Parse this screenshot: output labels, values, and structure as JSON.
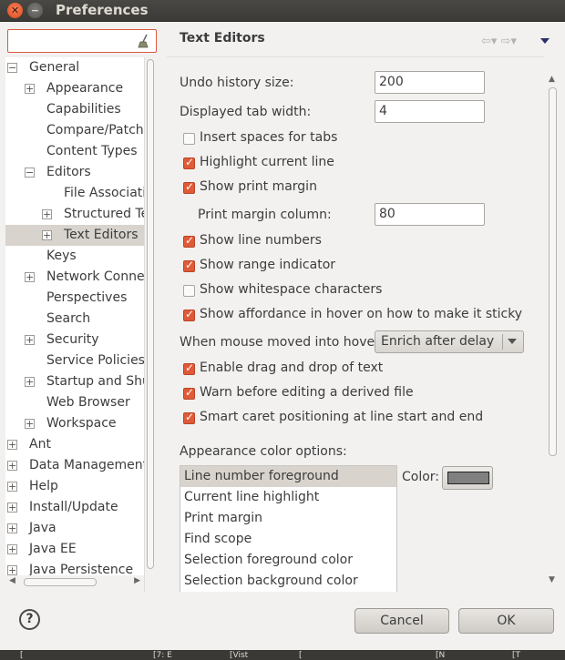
{
  "window": {
    "title": "Preferences",
    "close_glyph": "✕",
    "minimize_glyph": "−"
  },
  "filter": {
    "value": "",
    "icon": "broom-icon"
  },
  "tree": [
    {
      "label": "General",
      "exp": "−",
      "indent": 0
    },
    {
      "label": "Appearance",
      "exp": "+",
      "indent": 1
    },
    {
      "label": "Capabilities",
      "exp": "",
      "indent": 1
    },
    {
      "label": "Compare/Patch",
      "exp": "",
      "indent": 1
    },
    {
      "label": "Content Types",
      "exp": "",
      "indent": 1
    },
    {
      "label": "Editors",
      "exp": "−",
      "indent": 1
    },
    {
      "label": "File Associati",
      "exp": "",
      "indent": 2
    },
    {
      "label": "Structured Te",
      "exp": "+",
      "indent": 2
    },
    {
      "label": "Text Editors",
      "exp": "+",
      "indent": 2,
      "selected": true
    },
    {
      "label": "Keys",
      "exp": "",
      "indent": 1
    },
    {
      "label": "Network Connec",
      "exp": "+",
      "indent": 1
    },
    {
      "label": "Perspectives",
      "exp": "",
      "indent": 1
    },
    {
      "label": "Search",
      "exp": "",
      "indent": 1
    },
    {
      "label": "Security",
      "exp": "+",
      "indent": 1
    },
    {
      "label": "Service Policies",
      "exp": "",
      "indent": 1
    },
    {
      "label": "Startup and Shut",
      "exp": "+",
      "indent": 1
    },
    {
      "label": "Web Browser",
      "exp": "",
      "indent": 1
    },
    {
      "label": "Workspace",
      "exp": "+",
      "indent": 1
    },
    {
      "label": "Ant",
      "exp": "+",
      "indent": 0
    },
    {
      "label": "Data Management",
      "exp": "+",
      "indent": 0
    },
    {
      "label": "Help",
      "exp": "+",
      "indent": 0
    },
    {
      "label": "Install/Update",
      "exp": "+",
      "indent": 0
    },
    {
      "label": "Java",
      "exp": "+",
      "indent": 0
    },
    {
      "label": "Java EE",
      "exp": "+",
      "indent": 0
    },
    {
      "label": "Java Persistence",
      "exp": "+",
      "indent": 0
    }
  ],
  "page": {
    "title": "Text Editors",
    "nav_back": "⇦▾",
    "nav_forward": "⇨▾",
    "undo_label": "Undo history size:",
    "undo_value": "200",
    "tab_label": "Displayed tab width:",
    "tab_value": "4",
    "print_margin_label": "Print margin column:",
    "print_margin_value": "80",
    "hover_label": "When mouse moved into hover:",
    "hover_value": "Enrich after delay",
    "appearance_label": "Appearance color options:",
    "color_label": "Color:",
    "color_value": "#808080",
    "checkboxes_a": [
      {
        "label": "Insert spaces for tabs",
        "checked": false
      },
      {
        "label": "Highlight current line",
        "checked": true
      },
      {
        "label": "Show print margin",
        "checked": true
      }
    ],
    "checkboxes_b": [
      {
        "label": "Show line numbers",
        "checked": true
      },
      {
        "label": "Show range indicator",
        "checked": true
      },
      {
        "label": "Show whitespace characters",
        "checked": false
      },
      {
        "label": "Show affordance in hover on how to make it sticky",
        "checked": true
      }
    ],
    "checkboxes_c": [
      {
        "label": "Enable drag and drop of text",
        "checked": true
      },
      {
        "label": "Warn before editing a derived file",
        "checked": true
      },
      {
        "label": "Smart caret positioning at line start and end",
        "checked": true
      }
    ],
    "color_options": [
      "Line number foreground",
      "Current line highlight",
      "Print margin",
      "Find scope",
      "Selection foreground color",
      "Selection background color"
    ]
  },
  "buttons": {
    "help": "?",
    "cancel": "Cancel",
    "ok": "OK"
  },
  "taskbar": [
    "[",
    "[7: E",
    "[Vist",
    "[",
    "[N",
    "[T"
  ]
}
